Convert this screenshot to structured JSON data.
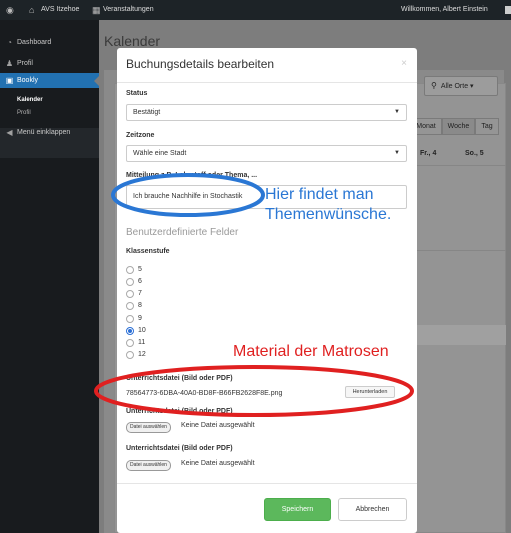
{
  "admin_bar": {
    "wp_logo": "wordpress-icon",
    "site_name": "AVS Itzehoe",
    "events": "Veranstaltungen",
    "greeting": "Willkommen, Albert Einstein"
  },
  "sidebar": {
    "items": [
      {
        "label": "Dashboard",
        "icon": "dashboard-icon"
      },
      {
        "label": "Profil",
        "icon": "user-icon"
      },
      {
        "label": "Bookly",
        "icon": "calendar-icon"
      }
    ],
    "submenu": [
      "Kalender",
      "Profil"
    ],
    "collapse": "Menü einklappen"
  },
  "background_page": {
    "title": "Kalender",
    "location_filter": "Alle Orte",
    "tabs": [
      "Monat",
      "Woche",
      "Tag"
    ],
    "active_tab": "Woche",
    "day_headers": [
      "Fr., 4",
      "So., 5"
    ]
  },
  "modal": {
    "title": "Buchungsdetails bearbeiten",
    "close": "×",
    "status": {
      "label": "Status",
      "value": "Bestätigt"
    },
    "timezone": {
      "label": "Zeitzone",
      "value": "Wähle eine Stadt"
    },
    "message": {
      "label": "Mitteilung z.B. Lehrstoff oder Thema, ...",
      "value": "Ich brauche Nachhilfe in Stochastik"
    },
    "custom_fields_heading": "Benutzerdefinierte Felder",
    "grade": {
      "label": "Klassenstufe",
      "options": [
        "5",
        "6",
        "7",
        "8",
        "9",
        "10",
        "11",
        "12"
      ],
      "selected": "10"
    },
    "files": [
      {
        "label": "Unterrichtsdatei (Bild oder PDF)",
        "file_name": "78564773-6DBA-40A0-BD8F-B66FB2628F8E.png",
        "download": "Herunterladen"
      },
      {
        "label": "Unterrichtsdatei (Bild oder PDF)",
        "choose": "Datei auswählen",
        "status": "Keine Datei ausgewählt"
      },
      {
        "label": "Unterrichtsdatei (Bild oder PDF)",
        "choose": "Datei auswählen",
        "status": "Keine Datei ausgewählt"
      }
    ],
    "save": "Speichern",
    "cancel": "Abbrechen"
  },
  "annotations": {
    "blue_line1": "Hier findet man",
    "blue_line2": "Themenwünsche.",
    "red": "Material der Matrosen",
    "blue_color": "#2a77d4",
    "red_color": "#e02020"
  },
  "colors": {
    "accent": "#2271b1",
    "save_green": "#5cb85c",
    "admin_bar": "#1d2327"
  }
}
